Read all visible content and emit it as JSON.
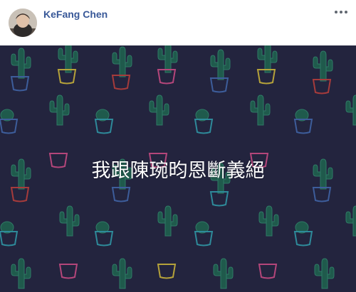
{
  "post": {
    "author_name": "KeFang Chen",
    "text": "我跟陳琬昀恩斷義絕"
  },
  "icons": {
    "more": "more-options-icon",
    "avatar": "profile-photo"
  },
  "colors": {
    "author": "#385898",
    "background": "#23243e",
    "text": "#ffffff",
    "cactus": "#1f5a4c",
    "pot_yellow": "#b5a23a",
    "pot_pink": "#b4467a",
    "pot_blue": "#3d5d9b",
    "pot_red": "#a63b3b"
  }
}
